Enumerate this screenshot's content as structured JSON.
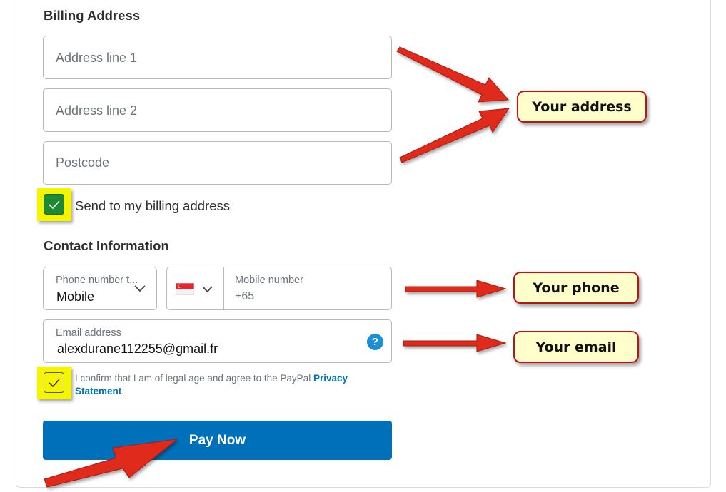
{
  "billing": {
    "heading": "Billing Address",
    "address1_placeholder": "Address line 1",
    "address2_placeholder": "Address line 2",
    "postcode_placeholder": "Postcode",
    "send_label": "Send to my billing address",
    "send_checked": true
  },
  "contact": {
    "heading": "Contact Information",
    "phone_type_label": "Phone number t...",
    "phone_type_value": "Mobile",
    "country_flag": "singapore-flag-icon",
    "mobile_label": "Mobile number",
    "mobile_prefix": "+65",
    "email_label": "Email address",
    "email_value": "alexdurane112255@gmail.fr",
    "help_icon": "?"
  },
  "consent": {
    "text": "I confirm that I am of legal age and agree to the PayPal ",
    "link": "Privacy Statement",
    "tail": ".",
    "checked": true
  },
  "pay_button": {
    "label": "Pay Now"
  },
  "callouts": {
    "address": "Your address",
    "phone": "Your phone",
    "email": "Your email"
  },
  "colors": {
    "brand_blue": "#0070ba",
    "highlight_yellow": "#f5f500",
    "callout_fill": "#ffffcc",
    "arrow_red": "#e02a1a",
    "check_green": "#1e8a32"
  }
}
